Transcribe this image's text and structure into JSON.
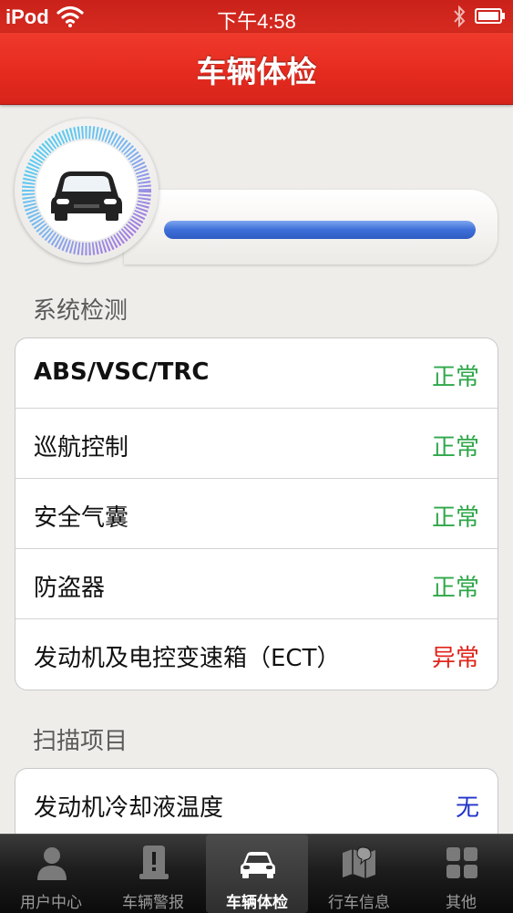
{
  "status_bar": {
    "carrier": "iPod",
    "time": "下午4:58"
  },
  "nav": {
    "title": "车辆体检"
  },
  "scan_progress": 1.0,
  "system_check": {
    "header": "系统检测",
    "items": [
      {
        "label": "ABS/VSC/TRC",
        "status": "正常",
        "status_color": "#2fa84a"
      },
      {
        "label": "巡航控制",
        "status": "正常",
        "status_color": "#2fa84a"
      },
      {
        "label": "安全气囊",
        "status": "正常",
        "status_color": "#2fa84a"
      },
      {
        "label": "防盗器",
        "status": "正常",
        "status_color": "#2fa84a"
      },
      {
        "label": "发动机及电控变速箱（ECT）",
        "status": "异常",
        "status_color": "#e0251c"
      }
    ]
  },
  "scan_items": {
    "header": "扫描项目",
    "items": [
      {
        "label": "发动机冷却液温度",
        "status": "无",
        "status_color": "#2233c8"
      }
    ]
  },
  "tabs": [
    {
      "label": "用户中心",
      "icon": "user-icon"
    },
    {
      "label": "车辆警报",
      "icon": "alert-icon"
    },
    {
      "label": "车辆体检",
      "icon": "car-icon",
      "active": true
    },
    {
      "label": "行车信息",
      "icon": "map-icon"
    },
    {
      "label": "其他",
      "icon": "grid-icon"
    }
  ]
}
